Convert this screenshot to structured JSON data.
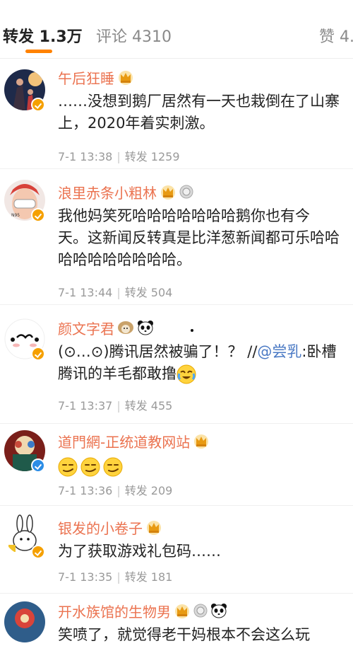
{
  "tabs": [
    {
      "label": "转发 1.3万",
      "active": true
    },
    {
      "label": "评论 4310",
      "active": false
    },
    {
      "label": "赞 4.",
      "active": false
    }
  ],
  "colors": {
    "accent": "#ff8200",
    "username": "#eb7350",
    "mention": "#4a79c4",
    "meta": "#9a9a9a"
  },
  "comments": [
    {
      "username": "午后狂睡",
      "badges": [
        "crown-icon"
      ],
      "lines": [
        "……没想到鹅厂居然有一天也栽倒在了山寨",
        "上，2020年着实刺激。"
      ],
      "meta": {
        "time": "7-1 13:38",
        "repost": "转发 1259"
      }
    },
    {
      "username": "浪里赤条小粗林",
      "badges": [
        "crown-icon",
        "medal-icon"
      ],
      "lines": [
        "我他妈笑死哈哈哈哈哈哈哈鹅你也有今",
        "天。这新闻反转真是比洋葱新闻都可乐哈哈",
        "哈哈哈哈哈哈哈哈。"
      ],
      "meta": {
        "time": "7-1 13:44",
        "repost": "转发 504"
      }
    },
    {
      "username": "颜文字君",
      "badges": [
        "sheep-icon",
        "panda-icon"
      ],
      "line1_prefix": "(⊙…⊙)腾讯居然被骗了！？ //",
      "mention": "@尝乳",
      "line1_suffix": ":卧槽",
      "line2": "腾讯的羊毛都敢撸",
      "meta": {
        "time": "7-1 13:37",
        "repost": "转发 455"
      }
    },
    {
      "username": "道門網-正统道教网站",
      "badges": [
        "crown-icon"
      ],
      "emojis": [
        "smirk-emoji",
        "smirk-emoji",
        "smirk-emoji"
      ],
      "meta": {
        "time": "7-1 13:36",
        "repost": "转发 209"
      }
    },
    {
      "username": "银发的小卷子",
      "badges": [
        "crown-icon"
      ],
      "lines": [
        "为了获取游戏礼包码……"
      ],
      "meta": {
        "time": "7-1 13:35",
        "repost": "转发 181"
      }
    },
    {
      "username": "开水族馆的生物男",
      "badges": [
        "crown-icon",
        "medal-icon",
        "panda-icon"
      ],
      "lines": [
        "笑喷了，就觉得老干妈根本不会这么玩"
      ]
    }
  ]
}
